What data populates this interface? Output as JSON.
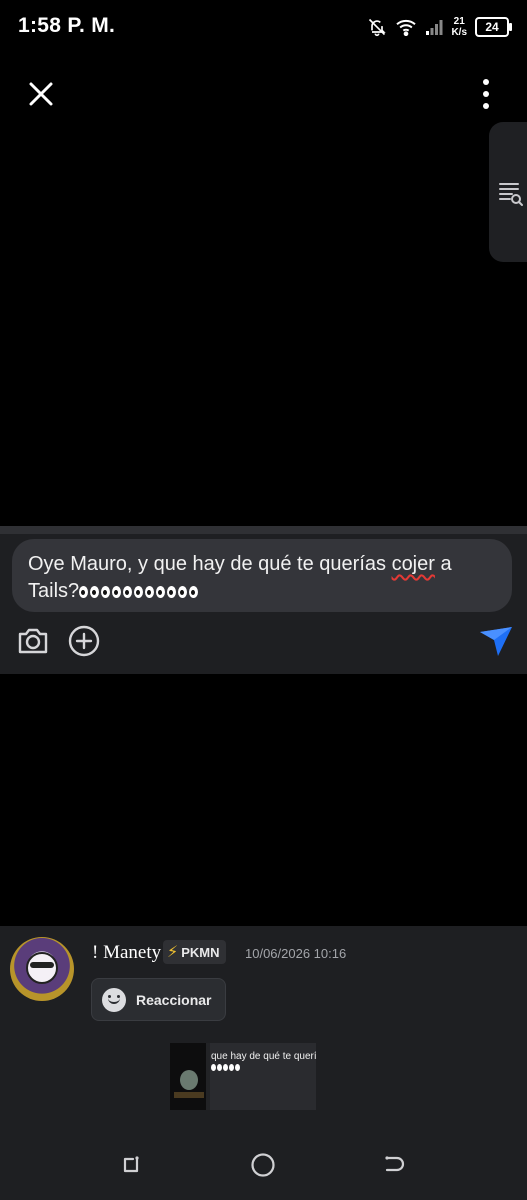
{
  "status_bar": {
    "time": "1:58 P. M.",
    "speed_value": "21",
    "speed_unit": "K/s",
    "battery": "24"
  },
  "top_bar": {
    "close_icon": "close-icon",
    "menu_icon": "more-vertical-icon",
    "side_panel_icon": "search-list-icon"
  },
  "composer": {
    "text_before": "Oye Mauro, y que hay de qué te querías ",
    "text_underlined": "cojer",
    "text_after": " a Tails?",
    "eye_emoji_count": 11,
    "actions": [
      "camera-icon",
      "add-icon",
      "send-icon"
    ],
    "send_color": "#1e6ff5"
  },
  "message": {
    "username": "! Manety",
    "role_badge": "PKMN",
    "timestamp": "10/06/2026 10:16",
    "react_label": "Reaccionar",
    "preview_text": "que hay de qué te querías"
  },
  "nav_bar": {
    "buttons": [
      "recent-apps-icon",
      "home-icon",
      "back-icon"
    ]
  }
}
